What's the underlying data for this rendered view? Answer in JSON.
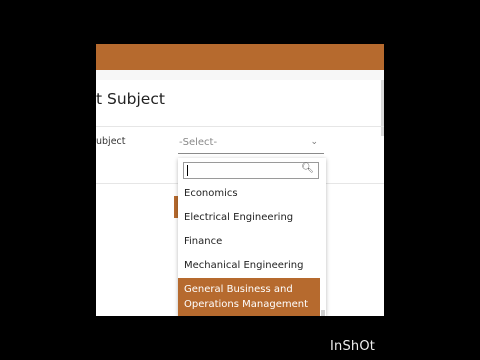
{
  "page": {
    "heading": "t Subject"
  },
  "form": {
    "field_label": "ubject",
    "select_value": "-Select-"
  },
  "dropdown": {
    "search_value": "",
    "options": [
      "Economics",
      "Electrical Engineering",
      "Finance",
      "Mechanical Engineering",
      "General Business and Operations Management"
    ],
    "selected_index": 4
  },
  "icons": {
    "chevron": "chevron-down-icon",
    "search": "search-icon"
  },
  "colors": {
    "accent": "#b66a2e"
  },
  "watermark": "InShOt"
}
